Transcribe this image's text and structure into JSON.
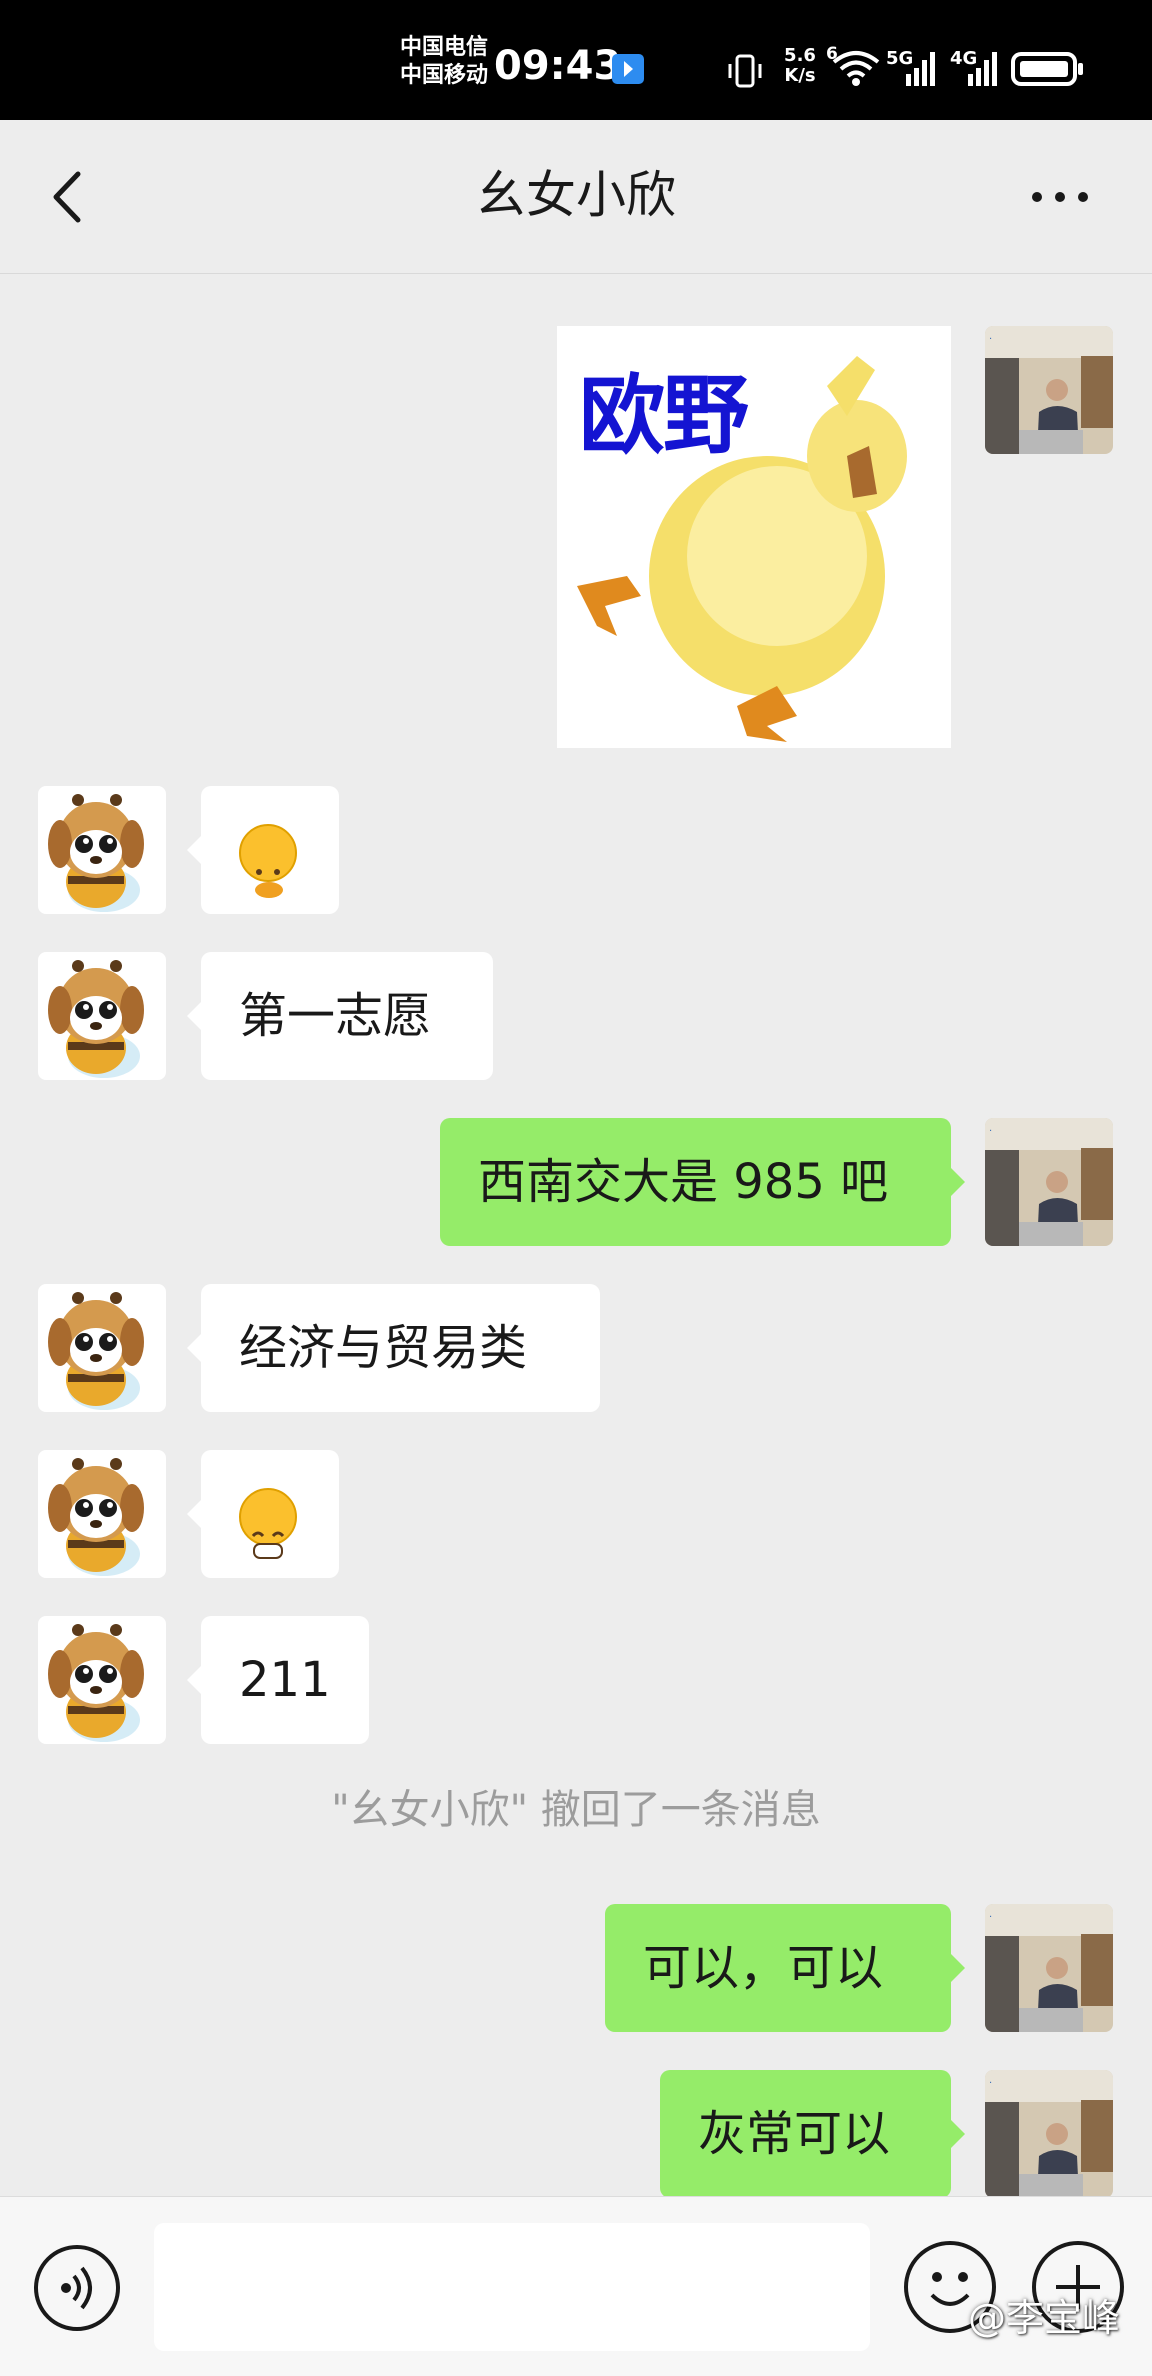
{
  "status_bar": {
    "carrier_1": "中国电信",
    "carrier_2": "中国移动",
    "time": "09:43",
    "net_speed_value": "5.6",
    "net_speed_unit": "K/s",
    "wifi_label": "6",
    "sim1_label": "5G",
    "sim2_label": "4G",
    "icons": [
      "bluetooth-app-icon",
      "vibrate-icon",
      "wifi-icon",
      "signal-5g-icon",
      "signal-4g-icon",
      "battery-icon"
    ]
  },
  "header": {
    "title": "幺女小欣",
    "back_icon": "chevron-left-icon",
    "more_icon": "more-dots-icon"
  },
  "messages": [
    {
      "from": "me",
      "type": "sticker",
      "text": "欧野"
    },
    {
      "from": "contact",
      "type": "emoji",
      "emoji": "🤭"
    },
    {
      "from": "contact",
      "type": "text",
      "text": "第一志愿"
    },
    {
      "from": "me",
      "type": "text",
      "text": "西南交大是 985 吧"
    },
    {
      "from": "contact",
      "type": "text",
      "text": "经济与贸易类"
    },
    {
      "from": "contact",
      "type": "emoji",
      "emoji": "😁"
    },
    {
      "from": "contact",
      "type": "text",
      "text": "211"
    },
    {
      "from": "me",
      "type": "text",
      "text": "可以，可以"
    },
    {
      "from": "me",
      "type": "text",
      "text": "灰常可以"
    }
  ],
  "recall_notice": "\"幺女小欣\" 撤回了一条消息",
  "input_bar": {
    "placeholder": "",
    "voice_icon": "voice-icon",
    "emoji_icon": "emoji-icon",
    "plus_icon": "plus-icon"
  },
  "watermark": "@李宝峰",
  "colors": {
    "chat_background": "#ededed",
    "outgoing_bubble": "#95ec69",
    "incoming_bubble": "#ffffff",
    "sticker_text": "#1414d2"
  }
}
